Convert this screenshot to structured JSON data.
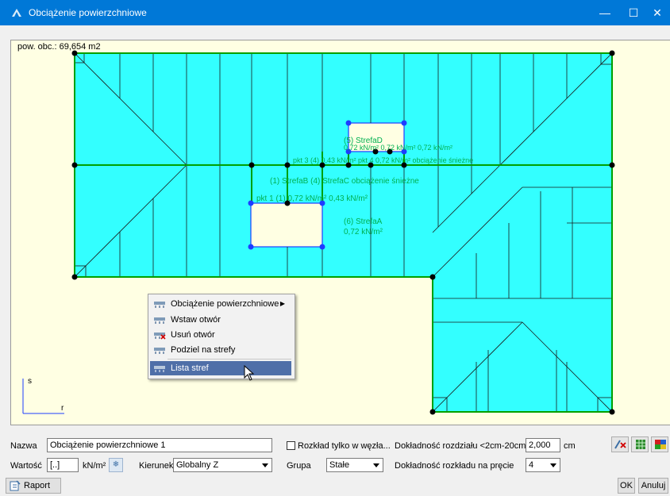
{
  "window": {
    "title": "Obciążenie powierzchniowe",
    "minimize_glyph": "—",
    "maximize_glyph": "☐",
    "close_glyph": "✕"
  },
  "canvas": {
    "area_label": "pow. obc.: 69,654 m2",
    "axis_s": "s",
    "axis_r": "r",
    "zone_labels": {
      "d1": "(5) StrefaD",
      "d2": "0,72 kN/m² 0,72 kN/m² 0,72 kN/m²",
      "d3": "pkt 3 (4) 0,43 kN/m² pkt 4 0,72 kN/m² obciążenie śnieżne",
      "c1": "(1) StrefaB (4) StrefaC obciążenie śnieżne",
      "c2": "pkt 1 (1) 0,72 kN/m² 0,43 kN/m²",
      "a1": "(6) StrefaA",
      "a2": "0,72 kN/m²"
    }
  },
  "context_menu": {
    "items": [
      {
        "label": "Obciążenie powierzchniowe",
        "icon": "load-icon",
        "submenu": true
      },
      {
        "label": "Wstaw otwór",
        "icon": "insert-hole-icon"
      },
      {
        "label": "Usuń otwór",
        "icon": "delete-hole-icon"
      },
      {
        "label": "Podziel na strefy",
        "icon": "split-zones-icon"
      },
      {
        "label": "Lista stref",
        "icon": "zone-list-icon",
        "selected": true
      }
    ]
  },
  "form": {
    "name_label": "Nazwa",
    "name_value": "Obciążenie powierzchniowe 1",
    "nodes_only_label": "Rozkład tylko w węzła...",
    "nodes_only_checked": false,
    "accuracy_label": "Dokładność rozdziału <2cm-20cm>",
    "accuracy_value": "2,000",
    "accuracy_unit": "cm",
    "value_label": "Wartość",
    "value_value": "[..]",
    "value_unit": "kN/m²",
    "direction_label": "Kierunek",
    "direction_value": "Globalny Z",
    "group_label": "Grupa",
    "group_value": "Stałe",
    "bar_accuracy_label": "Dokładność rozkładu na pręcie",
    "bar_accuracy_value": "4",
    "report_label": "Raport",
    "ok_label": "OK",
    "cancel_label": "Anuluj"
  },
  "colors": {
    "titlebar": "#0078d7",
    "canvas_bg": "#ffffe3",
    "area_fill": "#33ffff",
    "outline": "#00a000",
    "zone_text": "#00b050",
    "menu_highlight": "#4f6fa8"
  }
}
